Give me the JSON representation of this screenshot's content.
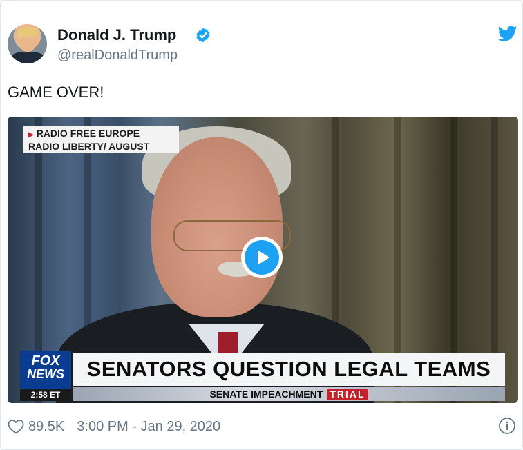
{
  "author": {
    "name": "Donald J. Trump",
    "handle": "@realDonaldTrump",
    "verified": true
  },
  "tweet": {
    "text": "GAME OVER!"
  },
  "media": {
    "source_line1": "RADIO FREE EUROPE",
    "source_line2": "RADIO LIBERTY/ AUGUST",
    "network_logo_top": "FOX",
    "network_logo_bottom": "NEWS",
    "clock": "2:58 ET",
    "headline": "SENATORS QUESTION LEGAL TEAMS",
    "subheadline": "SENATE IMPEACHMENT",
    "tag": "TRIAL"
  },
  "footer": {
    "likes": "89.5K",
    "timestamp": "3:00 PM - Jan 29, 2020"
  },
  "icons": {
    "brand": "twitter-bird-icon",
    "verified": "verified-badge-icon",
    "play": "play-icon",
    "like": "heart-icon",
    "info": "info-icon"
  },
  "colors": {
    "twitter_blue": "#1da1f2",
    "secondary_text": "#657786",
    "fox_blue": "#0a3d8f",
    "trial_red": "#c8202b"
  }
}
